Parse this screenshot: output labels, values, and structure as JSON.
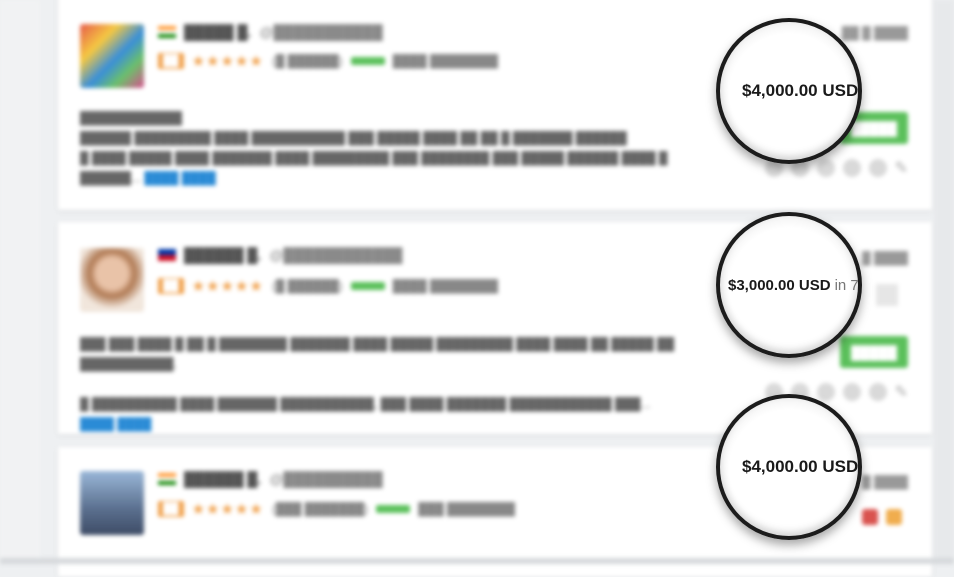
{
  "bids": [
    {
      "price": "$4,000.00 USD",
      "suffix": ""
    },
    {
      "price": "$3,000.00 USD",
      "suffix": "in 7"
    },
    {
      "price": "$4,000.00 USD",
      "suffix": ""
    }
  ],
  "colors": {
    "accent_green": "#5bc05b",
    "rating_orange": "#f0a04b",
    "link_blue": "#2a8bd6"
  }
}
